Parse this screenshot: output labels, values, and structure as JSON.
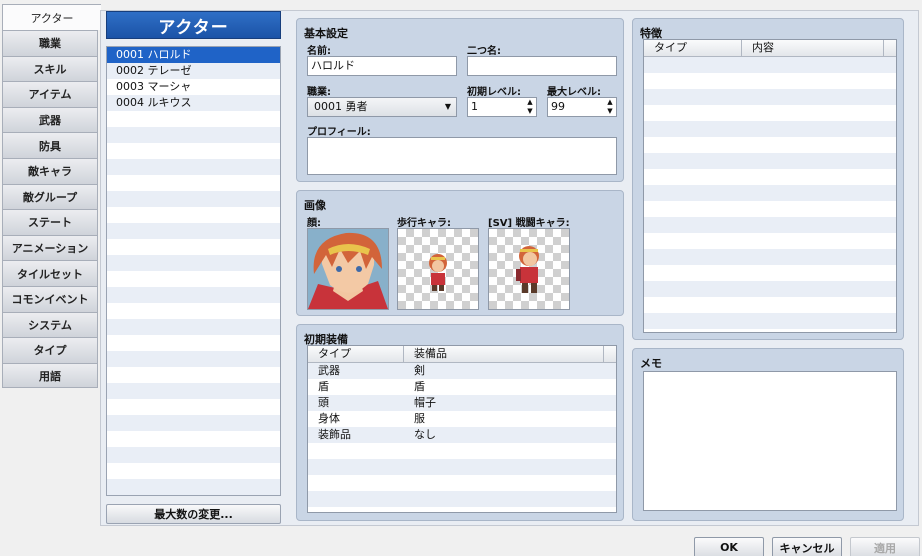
{
  "tabs": [
    "アクター",
    "職業",
    "スキル",
    "アイテム",
    "武器",
    "防具",
    "敵キャラ",
    "敵グループ",
    "ステート",
    "アニメーション",
    "タイルセット",
    "コモンイベント",
    "システム",
    "タイプ",
    "用語"
  ],
  "list": {
    "title": "アクター",
    "items": [
      "0001 ハロルド",
      "0002 テレーゼ",
      "0003 マーシャ",
      "0004 ルキウス"
    ],
    "max_button": "最大数の変更..."
  },
  "basic": {
    "title": "基本設定",
    "name_label": "名前:",
    "name_value": "ハロルド",
    "nickname_label": "二つ名:",
    "nickname_value": "",
    "class_label": "職業:",
    "class_value": "0001 勇者",
    "init_level_label": "初期レベル:",
    "init_level_value": "1",
    "max_level_label": "最大レベル:",
    "max_level_value": "99",
    "profile_label": "プロフィール:",
    "profile_value": ""
  },
  "images": {
    "title": "画像",
    "face_label": "顔:",
    "walk_label": "歩行キャラ:",
    "battle_label": "[SV] 戦闘キャラ:"
  },
  "equipment": {
    "title": "初期装備",
    "col_type": "タイプ",
    "col_item": "装備品",
    "rows": [
      {
        "type": "武器",
        "item": "剣"
      },
      {
        "type": "盾",
        "item": "盾"
      },
      {
        "type": "頭",
        "item": "帽子"
      },
      {
        "type": "身体",
        "item": "服"
      },
      {
        "type": "装飾品",
        "item": "なし"
      }
    ]
  },
  "traits": {
    "title": "特徴",
    "col_type": "タイプ",
    "col_content": "内容"
  },
  "memo": {
    "title": "メモ",
    "value": ""
  },
  "buttons": {
    "ok": "OK",
    "cancel": "キャンセル",
    "apply": "適用"
  },
  "colors": {
    "accent": "#1f63c7",
    "panel": "#c9d5e5"
  }
}
